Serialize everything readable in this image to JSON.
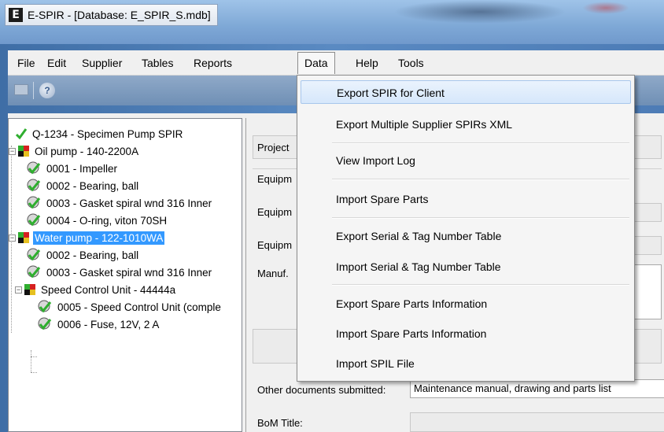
{
  "window": {
    "title": "E-SPIR - [Database: E_SPIR_S.mdb]",
    "icon_letter": "E"
  },
  "menubar": {
    "items": [
      "File",
      "Edit",
      "Supplier",
      "Tables",
      "Reports",
      "Data",
      "Help",
      "Tools"
    ],
    "open_menu": "Data"
  },
  "data_menu": {
    "items": [
      "Export SPIR for Client",
      "Export Multiple Supplier SPIRs XML",
      "View Import Log",
      "Import Spare Parts",
      "Export Serial & Tag Number Table",
      "Import Serial & Tag Number Table",
      "Export Spare Parts Information",
      "Import Spare Parts Information",
      "Import SPIL File"
    ],
    "highlighted": "Export SPIR for Client"
  },
  "tree": {
    "root": "Q-1234 - Specimen Pump SPIR",
    "equipment": [
      {
        "label": "Oil pump - 140-2200A",
        "parts": [
          "0001 - Impeller",
          "0002 - Bearing, ball",
          "0003 - Gasket spiral wnd 316 Inner",
          "0004 - O-ring, viton 70SH"
        ]
      },
      {
        "label": "Water pump - 122-1010WA",
        "selected": true,
        "parts": [
          "0002 - Bearing, ball",
          "0003 - Gasket spiral wnd 316 Inner"
        ]
      },
      {
        "label": "Speed Control Unit - 44444a",
        "parts": [
          "0005 - Speed Control Unit (comple",
          "0006 - Fuse, 12V, 2 A"
        ]
      }
    ]
  },
  "form": {
    "project_label": "Project",
    "equipment_group_label": "Equipm",
    "equipment_label_1": "Equipm",
    "equipment_label_2": "Equipm",
    "manuf_label": "Manuf.",
    "other_docs_label": "Other documents submitted:",
    "other_docs_value": "Maintenance manual, drawing and parts list",
    "bom_title_label": "BoM Title:"
  },
  "colors": {
    "selection": "#3399ff",
    "menu_highlight": "#d6e7fb",
    "check_green": "#2fae2f"
  }
}
